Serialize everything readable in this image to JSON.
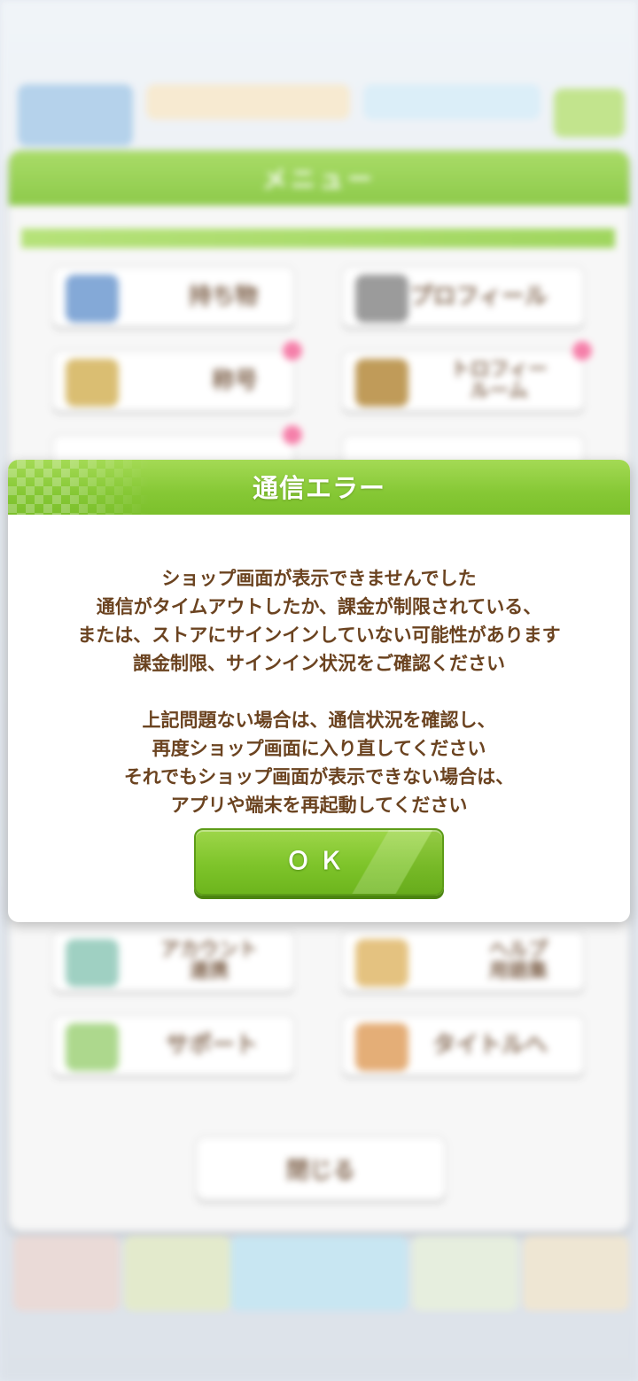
{
  "menu": {
    "title": "メニュー",
    "items": [
      {
        "label": "持ち物"
      },
      {
        "label": "プロフィール"
      },
      {
        "label": "称号"
      },
      {
        "label": "トロフィー\nルーム"
      },
      {
        "label": "アカウント\n連携"
      },
      {
        "label": "ヘルプ\n用語集"
      },
      {
        "label": "サポート"
      },
      {
        "label": "タイトルへ"
      }
    ],
    "close_label": "閉じる"
  },
  "dialog": {
    "title": "通信エラー",
    "lines": [
      "ショップ画面が表示できませんでした",
      "通信がタイムアウトしたか、課金が制限されている、",
      "または、ストアにサインインしていない可能性があります",
      "課金制限、サインイン状況をご確認ください"
    ],
    "lines2": [
      "上記問題ない場合は、通信状況を確認し、",
      "再度ショップ画面に入り直してください",
      "それでもショップ画面が表示できない場合は、",
      "アプリや端末を再起動してください"
    ],
    "ok_label": "ＯＫ"
  },
  "colors": {
    "accent_green": "#7ec42a",
    "text_brown": "#6b4320"
  }
}
